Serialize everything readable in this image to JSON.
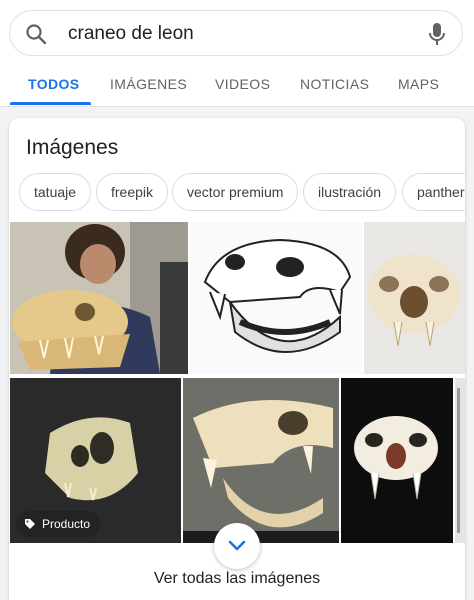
{
  "search": {
    "query": "craneo de leon"
  },
  "tabs": [
    {
      "label": "TODOS"
    },
    {
      "label": "IMÁGENES"
    },
    {
      "label": "VIDEOS"
    },
    {
      "label": "NOTICIAS"
    },
    {
      "label": "MAPS"
    }
  ],
  "images_card": {
    "title": "Imágenes",
    "chips": [
      "tatuaje",
      "freepik",
      "vector premium",
      "ilustración",
      "panthera"
    ],
    "badge_label": "Producto",
    "see_all": "Ver todas las imágenes"
  },
  "colors": {
    "accent": "#1a73e8",
    "chip_border": "#dadce0",
    "text": "#202124"
  }
}
